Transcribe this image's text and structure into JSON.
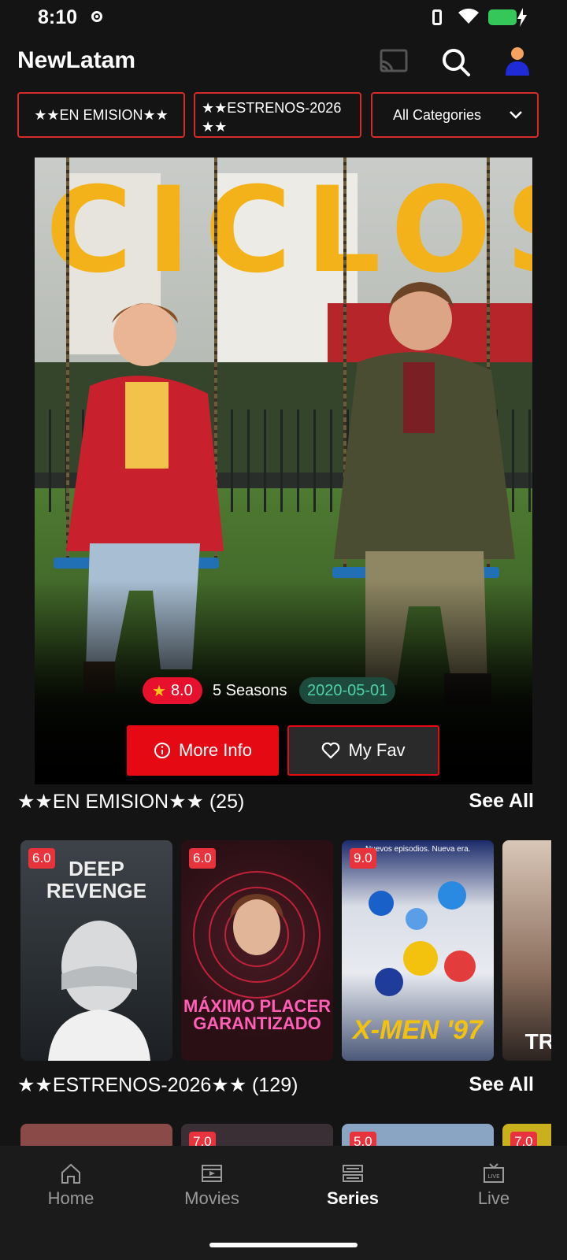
{
  "status_bar": {
    "time": "8:10"
  },
  "header": {
    "app_title": "NewLatam"
  },
  "filters": {
    "chip1": "★★EN EMISION★★",
    "chip2": "★★ESTRENOS-2026★★",
    "dropdown": "All Categories"
  },
  "hero": {
    "poster_title": "CICLOS",
    "rating": "8.0",
    "seasons": "5 Seasons",
    "date": "2020-05-01",
    "more_info_label": "More Info",
    "fav_label": "My Fav"
  },
  "row1": {
    "title": "★★EN EMISION★★ (25)",
    "see_all": "See All",
    "items": [
      {
        "rating": "6.0",
        "poster_text": "DEEP REVENGE"
      },
      {
        "rating": "6.0",
        "poster_text": "MÁXIMO PLACER GARANTIZADO"
      },
      {
        "rating": "9.0",
        "poster_text": "X-MEN '97",
        "tagline": "Nuevos episodios. Nueva era."
      },
      {
        "rating": "",
        "poster_text": "TR"
      }
    ]
  },
  "row2": {
    "title": "★★ESTRENOS-2026★★ (129)",
    "see_all": "See All",
    "items": [
      {
        "rating": ""
      },
      {
        "rating": "7.0"
      },
      {
        "rating": "5.0"
      },
      {
        "rating": "7.0"
      }
    ]
  },
  "bottom_nav": {
    "items": [
      {
        "label": "Home",
        "icon": "home-icon"
      },
      {
        "label": "Movies",
        "icon": "film-icon"
      },
      {
        "label": "Series",
        "icon": "series-icon",
        "active": true
      },
      {
        "label": "Live",
        "icon": "tv-icon"
      }
    ]
  },
  "colors": {
    "accent_red": "#e50914",
    "background": "#141414",
    "date_green": "#4fd1a7",
    "poster_yellow": "#f4b21a"
  }
}
